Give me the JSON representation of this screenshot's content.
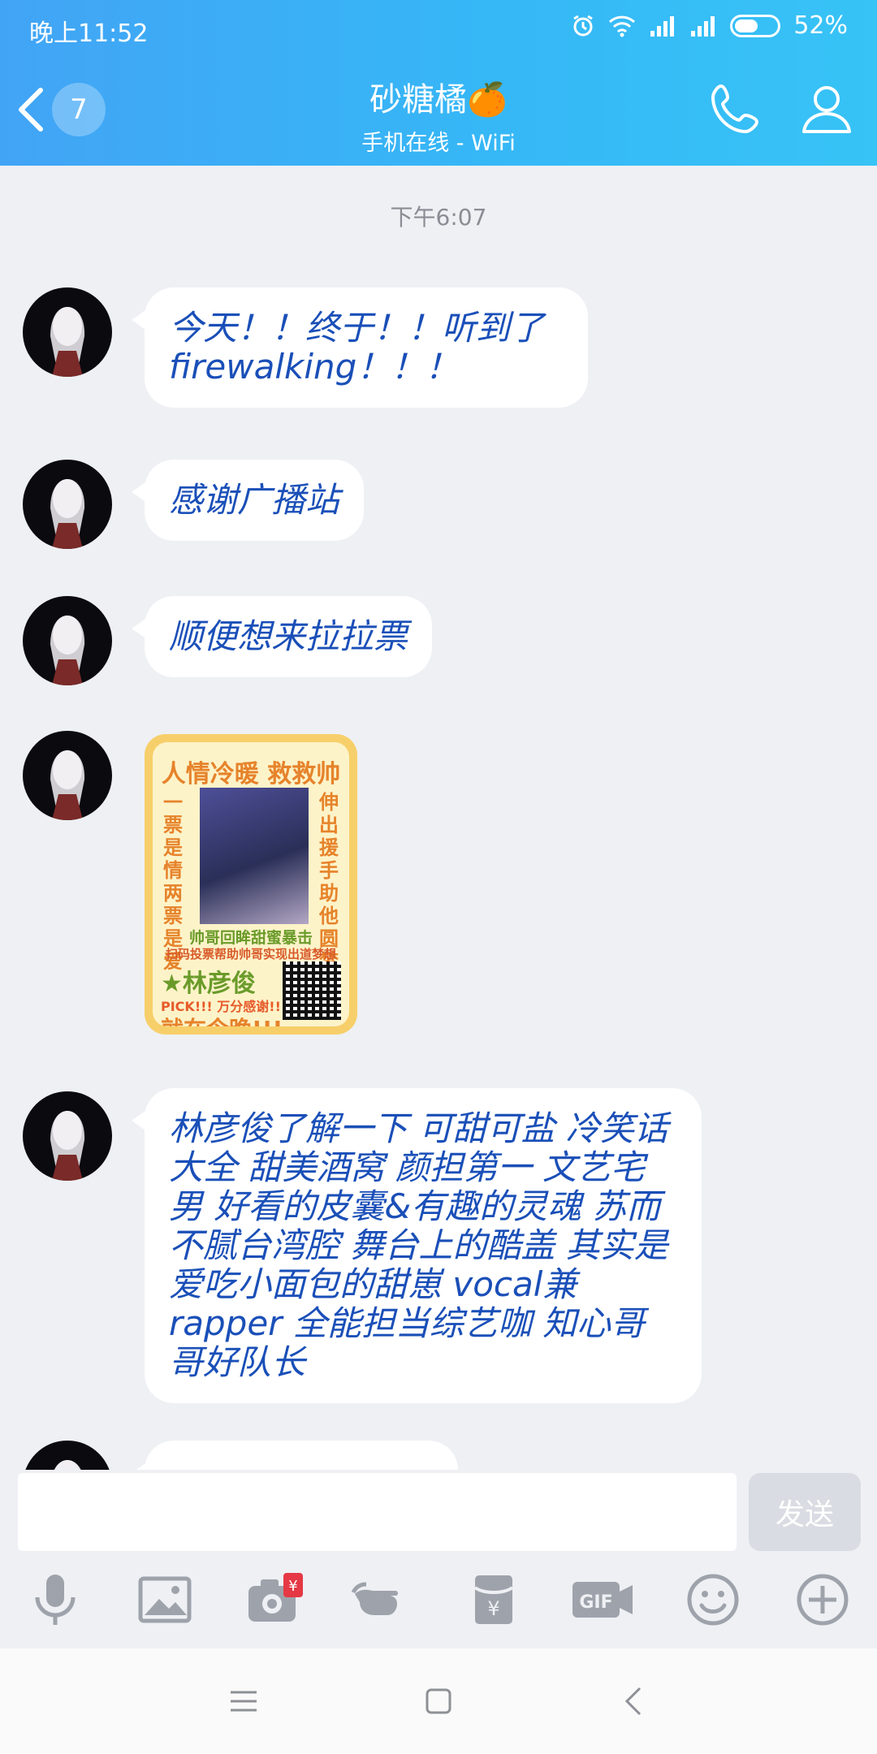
{
  "status_bar": {
    "time": "晚上11:52",
    "battery": "52%"
  },
  "header": {
    "back_badge": "7",
    "title": "砂糖橘",
    "title_emoji": "🍊",
    "subtitle": "手机在线 - WiFi"
  },
  "chat": {
    "timestamp": "下午6:07",
    "messages": [
      {
        "text": "今天！！终于！！听到了 firewalking！！！"
      },
      {
        "text": "感谢广播站"
      },
      {
        "text": "顺便想来拉拉票"
      },
      {
        "text": "林彦俊了解一下 可甜可盐 冷笑话大全 甜美酒窝 颜担第一 文艺宅男 好看的皮囊&有趣的灵魂 苏而不腻台湾腔 舞台上的酷盖 其实是爱吃小面包的甜崽 vocal兼rapper 全能担当综艺咖 知心哥哥好队长"
      }
    ],
    "sticker": {
      "title": "人情冷暖 救救帅哥",
      "left_vertical": "一票是情 两票是爱",
      "right_vertical": "伸出援手 助他圆梦",
      "line1": "帅哥回眸甜蜜暴击",
      "line2": "扫码投票帮助帅哥实现出道梦想",
      "name": "★林彦俊",
      "pick": "PICK!!! 万分感谢!!",
      "tonight": "就在今晚!!!"
    }
  },
  "input": {
    "placeholder": "",
    "send_label": "发送"
  },
  "colors": {
    "header_start": "#42a4f5",
    "header_end": "#37c3f6",
    "message_text": "#1a4fb8"
  }
}
